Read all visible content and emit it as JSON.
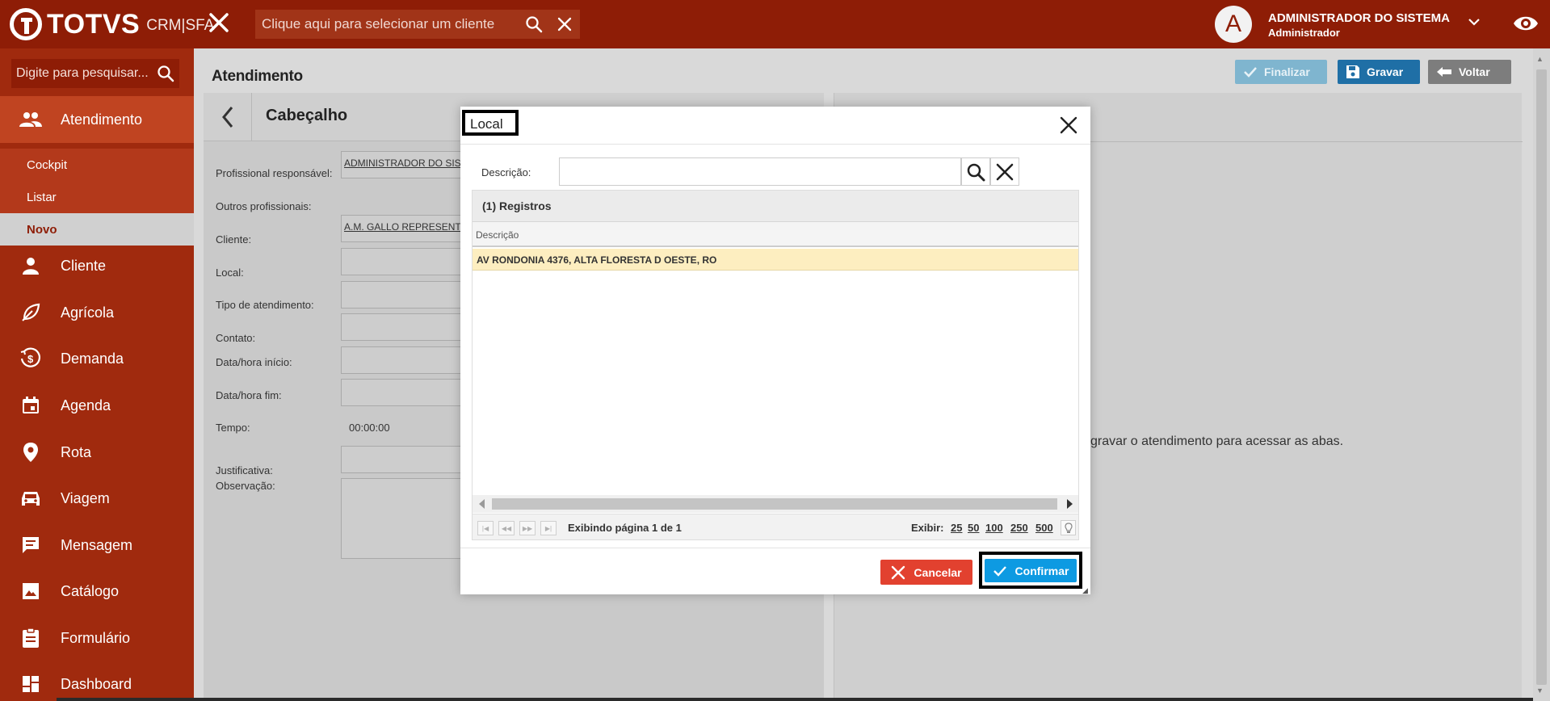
{
  "header": {
    "brand": "TOTVS",
    "product": "CRM|SFA",
    "client_placeholder": "Clique aqui para selecionar um cliente",
    "avatar_letter": "A",
    "user_name": "ADMINISTRADOR DO SISTEMA",
    "user_role": "Administrador"
  },
  "sidebar": {
    "search_placeholder": "Digite para pesquisar...",
    "items": [
      {
        "label": "Atendimento",
        "icon": "people-icon"
      },
      {
        "label": "Cliente",
        "icon": "person-icon"
      },
      {
        "label": "Agrícola",
        "icon": "leaf-icon"
      },
      {
        "label": "Demanda",
        "icon": "dollar-icon"
      },
      {
        "label": "Agenda",
        "icon": "calendar-icon"
      },
      {
        "label": "Rota",
        "icon": "pin-icon"
      },
      {
        "label": "Viagem",
        "icon": "car-icon"
      },
      {
        "label": "Mensagem",
        "icon": "message-icon"
      },
      {
        "label": "Catálogo",
        "icon": "image-icon"
      },
      {
        "label": "Formulário",
        "icon": "clipboard-icon"
      },
      {
        "label": "Dashboard",
        "icon": "dashboard-icon"
      }
    ],
    "submenu": [
      {
        "label": "Cockpit"
      },
      {
        "label": "Listar"
      },
      {
        "label": "Novo"
      }
    ]
  },
  "page": {
    "title": "Atendimento",
    "finalizar_label": "Finalizar",
    "gravar_label": "Gravar",
    "voltar_label": "Voltar"
  },
  "form": {
    "section_title": "Cabeçalho",
    "labels": {
      "profissional": "Profissional responsável:",
      "outros": "Outros profissionais:",
      "cliente": "Cliente:",
      "local": "Local:",
      "tipo": "Tipo de atendimento:",
      "contato": "Contato:",
      "inicio": "Data/hora início:",
      "fim": "Data/hora fim:",
      "tempo": "Tempo:",
      "justificativa": "Justificativa:",
      "observacao": "Observação:"
    },
    "values": {
      "profissional": "ADMINISTRADOR DO SISTEMA",
      "cliente": "A.M. GALLO REPRESENTAÇÕES",
      "tempo": "00:00:00"
    }
  },
  "right_panel": {
    "message_fragment": "gravar o atendimento para acessar as abas."
  },
  "modal": {
    "title": "Local",
    "desc_label": "Descrição:",
    "desc_value": "",
    "records_caption": "(1) Registros",
    "column_header": "Descrição",
    "rows": [
      "AV RONDONIA 4376, ALTA FLORESTA D OESTE, RO"
    ],
    "pager_info": "Exibindo página 1 de 1",
    "show_label": "Exibir:",
    "page_sizes": [
      "25",
      "50",
      "100",
      "250",
      "500"
    ],
    "cancel_label": "Cancelar",
    "confirm_label": "Confirmar"
  },
  "colors": {
    "brand_dark": "#8e1d06",
    "sidebar": "#a02a0e",
    "selected_row": "#fdeec0",
    "confirm": "#0d9ae2",
    "cancel": "#e2412f",
    "gravar": "#1f6fa6"
  }
}
